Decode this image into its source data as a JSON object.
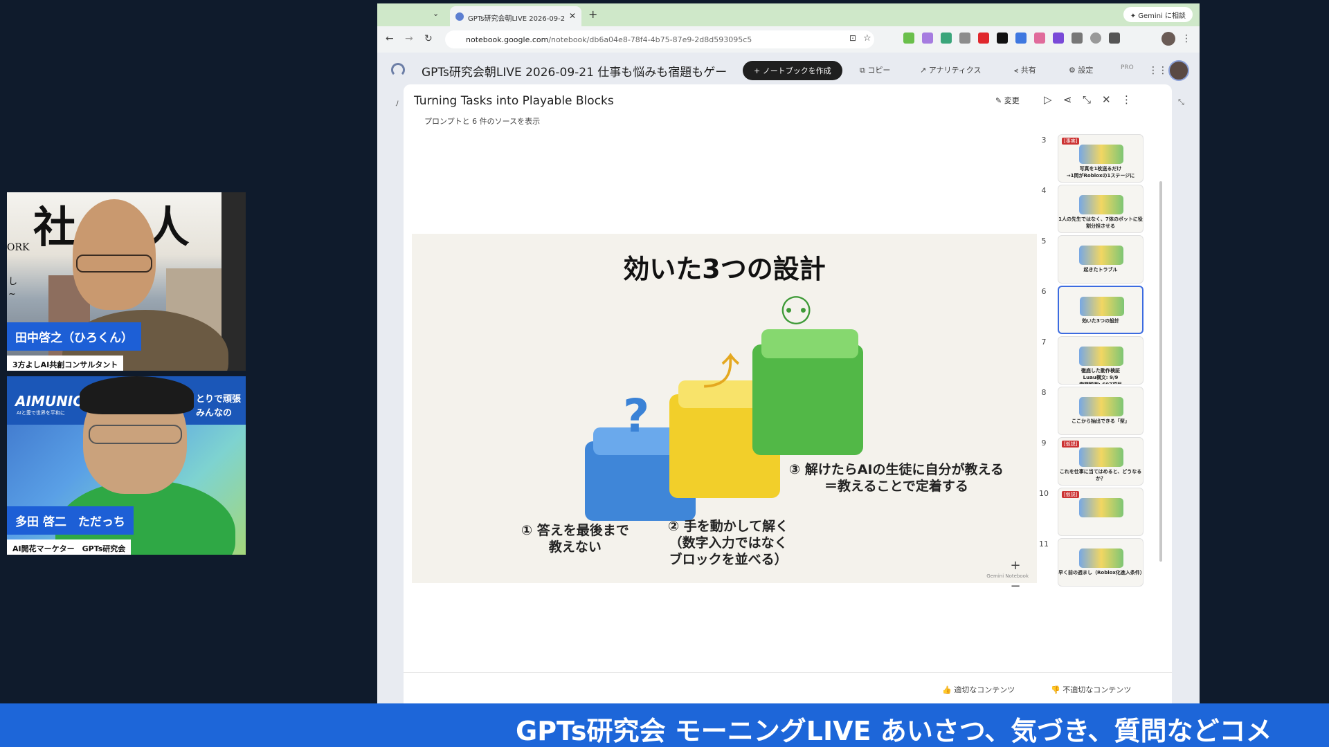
{
  "participants": [
    {
      "name": "田中啓之（ひろくん）",
      "role": "3方よしAI共創コンサルタント",
      "bg_chars": "社 無人",
      "bg_left": "ORK",
      "bg_side1": "し",
      "bg_side2": "~"
    },
    {
      "name": "多田 啓二　ただっち",
      "role": "AI開花マーケター　GPTs研究会",
      "bg_brand": "AIMUNIC",
      "bg_tagline": "AIと愛で世界を平和に",
      "bg_right1": "とりで頑張",
      "bg_right2": "みんなの"
    }
  ],
  "browser": {
    "tab_title": "GPTs研究会朝LIVE 2026-09-2",
    "url_host": "notebook.google.com",
    "url_path": "/notebook/db6a04e8-78f4-4b75-87e9-2d8d593095c5",
    "gemini_button": "Gemini に相談"
  },
  "app": {
    "notebook_title": "GPTs研究会朝LIVE 2026-09-21 仕事も悩みも宿題もゲー",
    "create_button": "+ ノートブックを作成",
    "copy": "コピー",
    "analytics": "アナリティクス",
    "share": "共有",
    "settings": "設定",
    "pro": "PRO"
  },
  "studio": {
    "title": "Turning Tasks into Playable Blocks",
    "subtitle": "プロンプトと 6 件のソースを表示",
    "edit_label": "変更"
  },
  "slide": {
    "title": "効いた3つの設計",
    "step1": "① 答えを最後まで\n教えない",
    "step2": "② 手を動かして解く\n（数字入力ではなく\nブロックを並べる）",
    "step3": "③ 解けたらAIの生徒に自分が教える\n＝教えることで定着する",
    "footer": "Gemini Notebook"
  },
  "thumbnails": [
    {
      "num": "3",
      "tag": "[事実]",
      "text": "写真を1枚送るだけ\n→1問がRobloxの1ステージに"
    },
    {
      "num": "4",
      "tag": "",
      "text": "1人の先生ではなく、7体のボットに役割分担させる"
    },
    {
      "num": "5",
      "tag": "",
      "text": "起きたトラブル"
    },
    {
      "num": "6",
      "tag": "",
      "text": "効いた3つの設計",
      "selected": true
    },
    {
      "num": "7",
      "tag": "",
      "text": "徹底した動作検証\nLuau構文: 9/9\n学習観測: 607項目\nエンジン検証: 29項目"
    },
    {
      "num": "8",
      "tag": "",
      "text": "ここから抽出できる「型」"
    },
    {
      "num": "9",
      "tag": "[仮説]",
      "text": "これを仕事に当てはめると、どうなるか？"
    },
    {
      "num": "10",
      "tag": "[仮説]",
      "text": ""
    },
    {
      "num": "11",
      "tag": "",
      "text": "早く前の週まし（Roblox化進入条件）"
    }
  ],
  "feedback": {
    "good": "適切なコンテンツ",
    "bad": "不適切なコンテンツ"
  },
  "ticker": "GPTs研究会 モーニングLIVE あいさつ、気づき、質問などコメ",
  "colors": {
    "accent": "#1d66d9",
    "tabstrip": "#cfe8c9",
    "cube_blue": "#3f86d8",
    "cube_yellow": "#f2cf2a",
    "cube_green": "#52b847"
  }
}
